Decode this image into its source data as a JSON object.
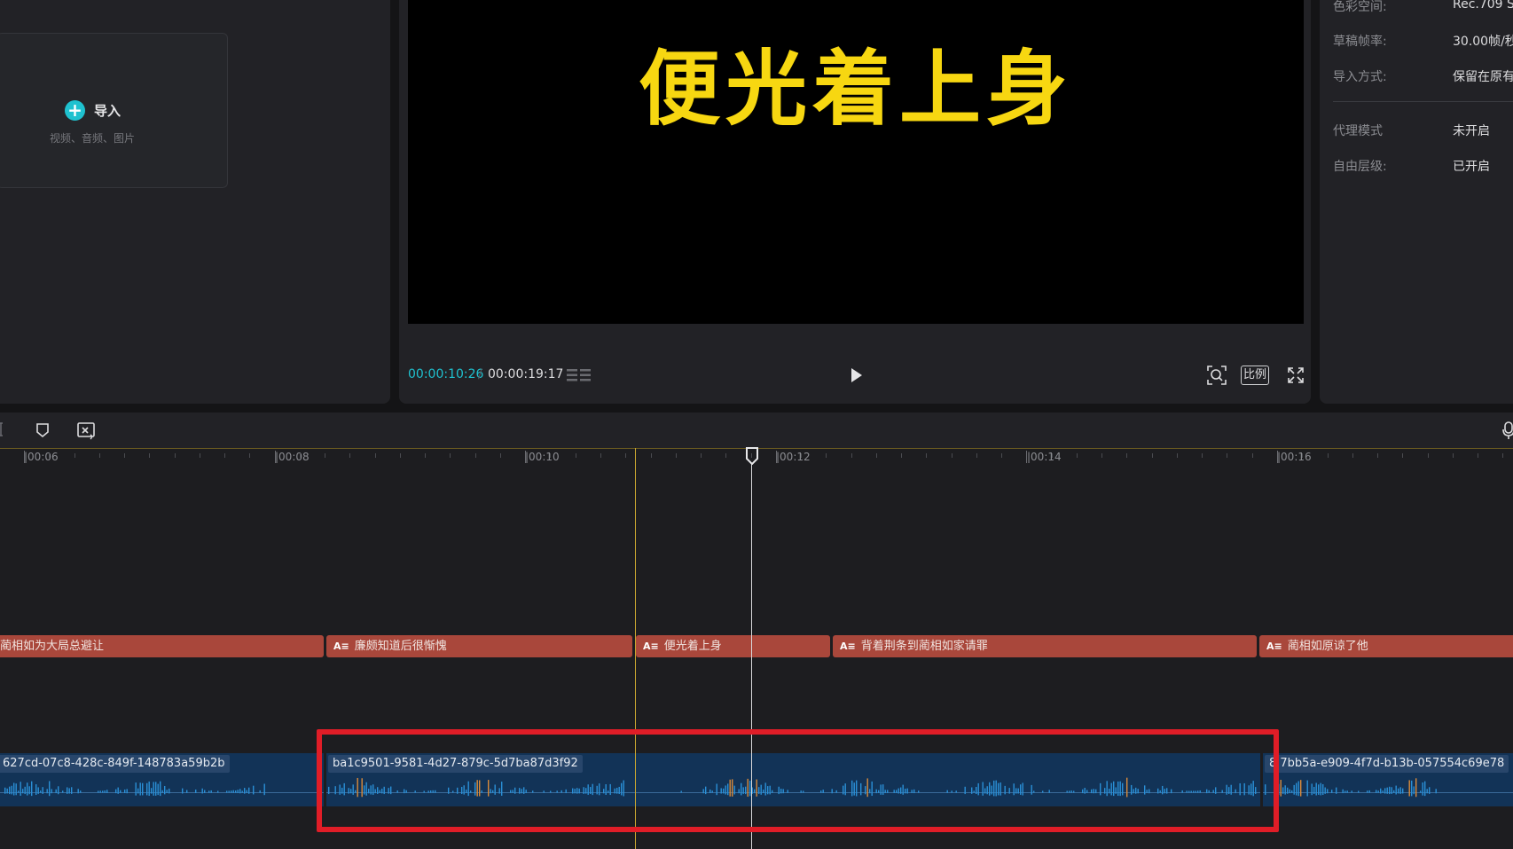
{
  "media": {
    "import_label": "导入",
    "import_hint": "视频、音频、图片",
    "plus_glyph": "+"
  },
  "preview": {
    "subtitle": "便光着上身",
    "time_current": "00:00:10:26",
    "time_separator": "/",
    "time_total": "00:00:19:17",
    "ratio_label": "比例"
  },
  "properties": {
    "rows": [
      {
        "label": "色彩空间:",
        "value": "Rec.709 S"
      },
      {
        "label": "草稿帧率:",
        "value": "30.00帧/秒"
      },
      {
        "label": "导入方式:",
        "value": "保留在原有"
      },
      {
        "label": "代理模式",
        "value": "未开启"
      },
      {
        "label": "自由层级:",
        "value": "已开启"
      }
    ]
  },
  "timeline": {
    "ruler_labels": [
      "|00:06",
      "|00:08",
      "|00:10",
      "|00:12",
      "|00:14",
      "|00:16"
    ],
    "text_clips": [
      {
        "icon": "",
        "label": "蔺相如为大局总避让"
      },
      {
        "icon": "A≡",
        "label": "廉颇知道后很惭愧"
      },
      {
        "icon": "A≡",
        "label": "便光着上身"
      },
      {
        "icon": "A≡",
        "label": "背着荆条到蔺相如家请罪"
      },
      {
        "icon": "A≡",
        "label": "蔺相如原谅了他"
      }
    ],
    "audio_clips": [
      {
        "label": "627cd-07c8-428c-849f-148783a59b2b"
      },
      {
        "label": "ba1c9501-9581-4d27-879c-5d7ba87d3f92"
      },
      {
        "label": "8 7bb5a-e909-4f7d-b13b-057554c69e78"
      }
    ]
  },
  "colors": {
    "accent": "#1fc1cf",
    "subtitle": "#f7d711",
    "text_clip": "#a9473b",
    "audio_clip": "#123357",
    "waveform": "#2a8fd6",
    "highlight": "#e01d27",
    "mark_line": "#c9a630"
  },
  "icons": [
    "plus-icon",
    "list-icon",
    "play-icon",
    "zoom-icon",
    "fullscreen-icon",
    "marker-icon",
    "freeze-frame-icon",
    "microphone-icon",
    "text-clip-icon",
    "playhead-icon"
  ]
}
